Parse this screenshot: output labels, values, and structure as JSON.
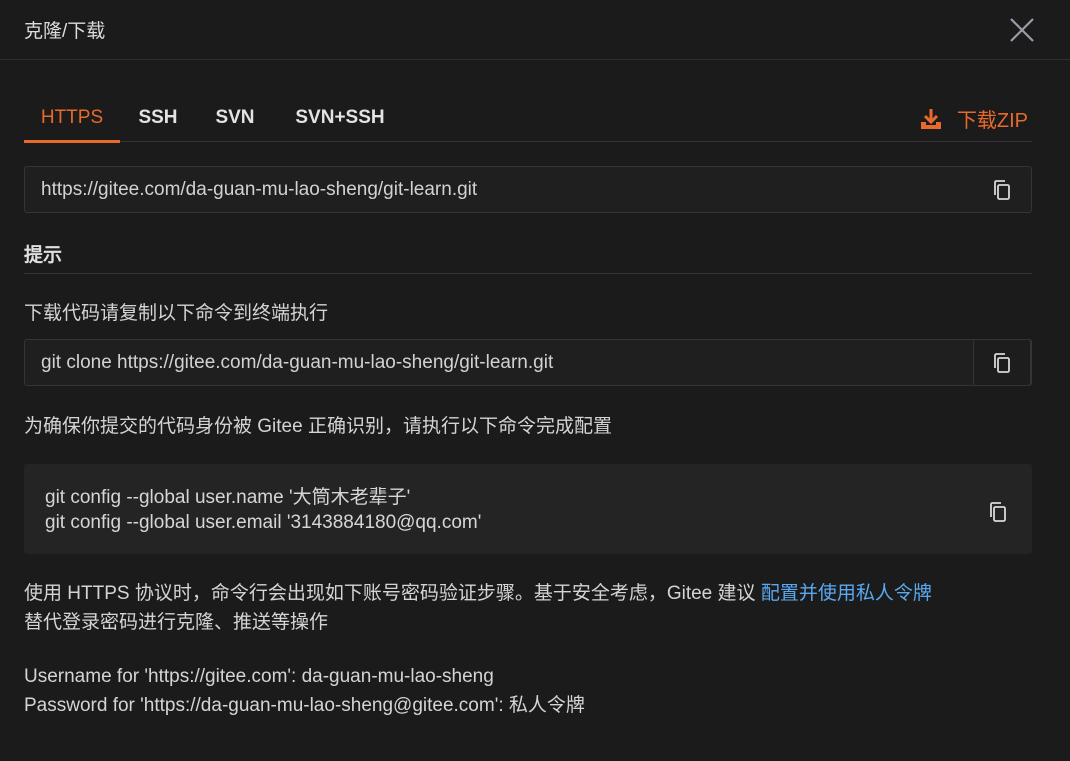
{
  "dialog": {
    "title": "克隆/下载"
  },
  "tabs": [
    {
      "label": "HTTPS",
      "active": true
    },
    {
      "label": "SSH",
      "active": false
    },
    {
      "label": "SVN",
      "active": false
    },
    {
      "label": "SVN+SSH",
      "active": false
    }
  ],
  "download": {
    "label": "下载ZIP",
    "icon": "download-icon"
  },
  "repo_url": "https://gitee.com/da-guan-mu-lao-sheng/git-learn.git",
  "hint": {
    "title": "提示",
    "clone_instruction": "下载代码请复制以下命令到终端执行",
    "clone_command": "git clone https://gitee.com/da-guan-mu-lao-sheng/git-learn.git",
    "config_instruction": "为确保你提交的代码身份被 Gitee 正确识别，请执行以下命令完成配置",
    "config_lines": [
      "git config --global user.name '大筒木老辈子'",
      "git config --global user.email '3143884180@qq.com'"
    ],
    "https_note_prefix": "使用 HTTPS 协议时，命令行会出现如下账号密码验证步骤。基于安全考虑，Gitee 建议 ",
    "https_note_link": "配置并使用私人令牌",
    "https_note_suffix": "替代登录密码进行克隆、推送等操作",
    "username_line": "Username for 'https://gitee.com': da-guan-mu-lao-sheng",
    "password_line": "Password for 'https://da-guan-mu-lao-sheng@gitee.com': 私人令牌"
  },
  "colors": {
    "accent": "#e8692c",
    "link": "#5aa9f0",
    "background": "#1b1b1c"
  }
}
